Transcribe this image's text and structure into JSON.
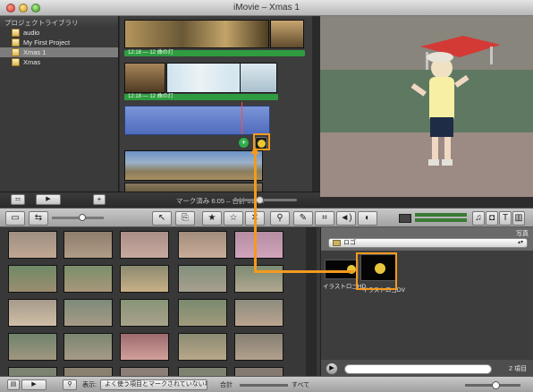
{
  "window": {
    "title": "iMovie – Xmas 1"
  },
  "library": {
    "header": "プロジェクトライブラリ",
    "items": [
      {
        "label": "audio",
        "selected": false
      },
      {
        "label": "My First Project",
        "selected": false
      },
      {
        "label": "Xmas 1",
        "selected": true
      },
      {
        "label": "Xmas",
        "selected": false
      }
    ]
  },
  "project": {
    "clips": [
      {
        "caption": "12:18 ― 12 曲の灯"
      },
      {
        "caption": "12:18 ― 12 曲の灯"
      }
    ],
    "status": "マーク済み 6:05 – 合計 31:04"
  },
  "toolbar": {
    "right_buttons": [
      "♫",
      "◘",
      "T",
      "▥"
    ]
  },
  "right_panel": {
    "title": "写真",
    "folder": "ロゴ",
    "items": [
      {
        "caption": "イラストロゴHD"
      },
      {
        "caption": "イラストロゴDV"
      }
    ],
    "count": "2 項目"
  },
  "bottombar": {
    "display_label": "表示:",
    "filter_value": "よく使う項目とマークされていない項目",
    "total_label": "合計",
    "all_label": "すべて"
  },
  "colors": {
    "accent_orange": "#f39a1e",
    "clip_green": "#2f9c41",
    "audio_blue": "#5470c0"
  }
}
